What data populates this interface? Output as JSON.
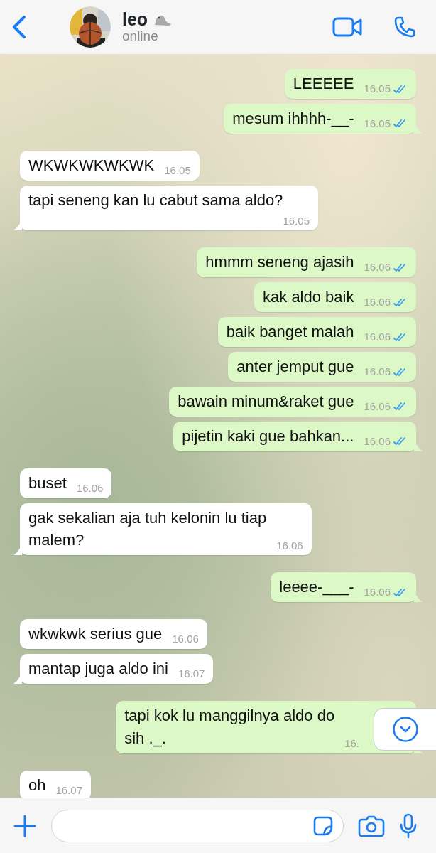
{
  "header": {
    "back": true,
    "contact_name": "leo",
    "status": "online"
  },
  "messages": [
    {
      "kind": "outgoing",
      "text": "LEEEEE",
      "time": "16.05",
      "read": true,
      "tail": false
    },
    {
      "kind": "outgoing",
      "text": "mesum ihhhh-__-",
      "time": "16.05",
      "read": true,
      "tail": true
    },
    {
      "kind": "incoming",
      "text": "WKWKWKWKWK",
      "time": "16.05",
      "tail": false
    },
    {
      "kind": "incoming",
      "text": "tapi seneng kan lu cabut sama aldo?",
      "time": "16.05",
      "tail": true
    },
    {
      "kind": "outgoing",
      "text": "hmmm seneng ajasih",
      "time": "16.06",
      "read": true,
      "tail": false
    },
    {
      "kind": "outgoing",
      "text": "kak aldo baik",
      "time": "16.06",
      "read": true,
      "tail": false
    },
    {
      "kind": "outgoing",
      "text": "baik banget malah",
      "time": "16.06",
      "read": true,
      "tail": false
    },
    {
      "kind": "outgoing",
      "text": "anter jemput gue",
      "time": "16.06",
      "read": true,
      "tail": false
    },
    {
      "kind": "outgoing",
      "text": "bawain minum&raket gue",
      "time": "16.06",
      "read": true,
      "tail": false
    },
    {
      "kind": "outgoing",
      "text": "pijetin kaki gue bahkan...",
      "time": "16.06",
      "read": true,
      "tail": true
    },
    {
      "kind": "incoming",
      "text": "buset",
      "time": "16.06",
      "tail": false
    },
    {
      "kind": "incoming",
      "text": "gak sekalian aja tuh kelonin lu tiap\nmalem?",
      "time": "16.06",
      "tail": true
    },
    {
      "kind": "outgoing",
      "text": "leeee-___-",
      "time": "16.06",
      "read": true,
      "tail": true
    },
    {
      "kind": "incoming",
      "text": "wkwkwk serius gue",
      "time": "16.06",
      "tail": false
    },
    {
      "kind": "incoming",
      "text": "mantap juga aldo ini",
      "time": "16.07",
      "tail": true
    },
    {
      "kind": "outgoing",
      "text": "tapi kok lu manggilnya aldo do\nsih ._.",
      "time": "16.",
      "covered": true,
      "tail": true
    },
    {
      "kind": "incoming",
      "text": "oh",
      "time": "16.07",
      "tail": false
    }
  ]
}
